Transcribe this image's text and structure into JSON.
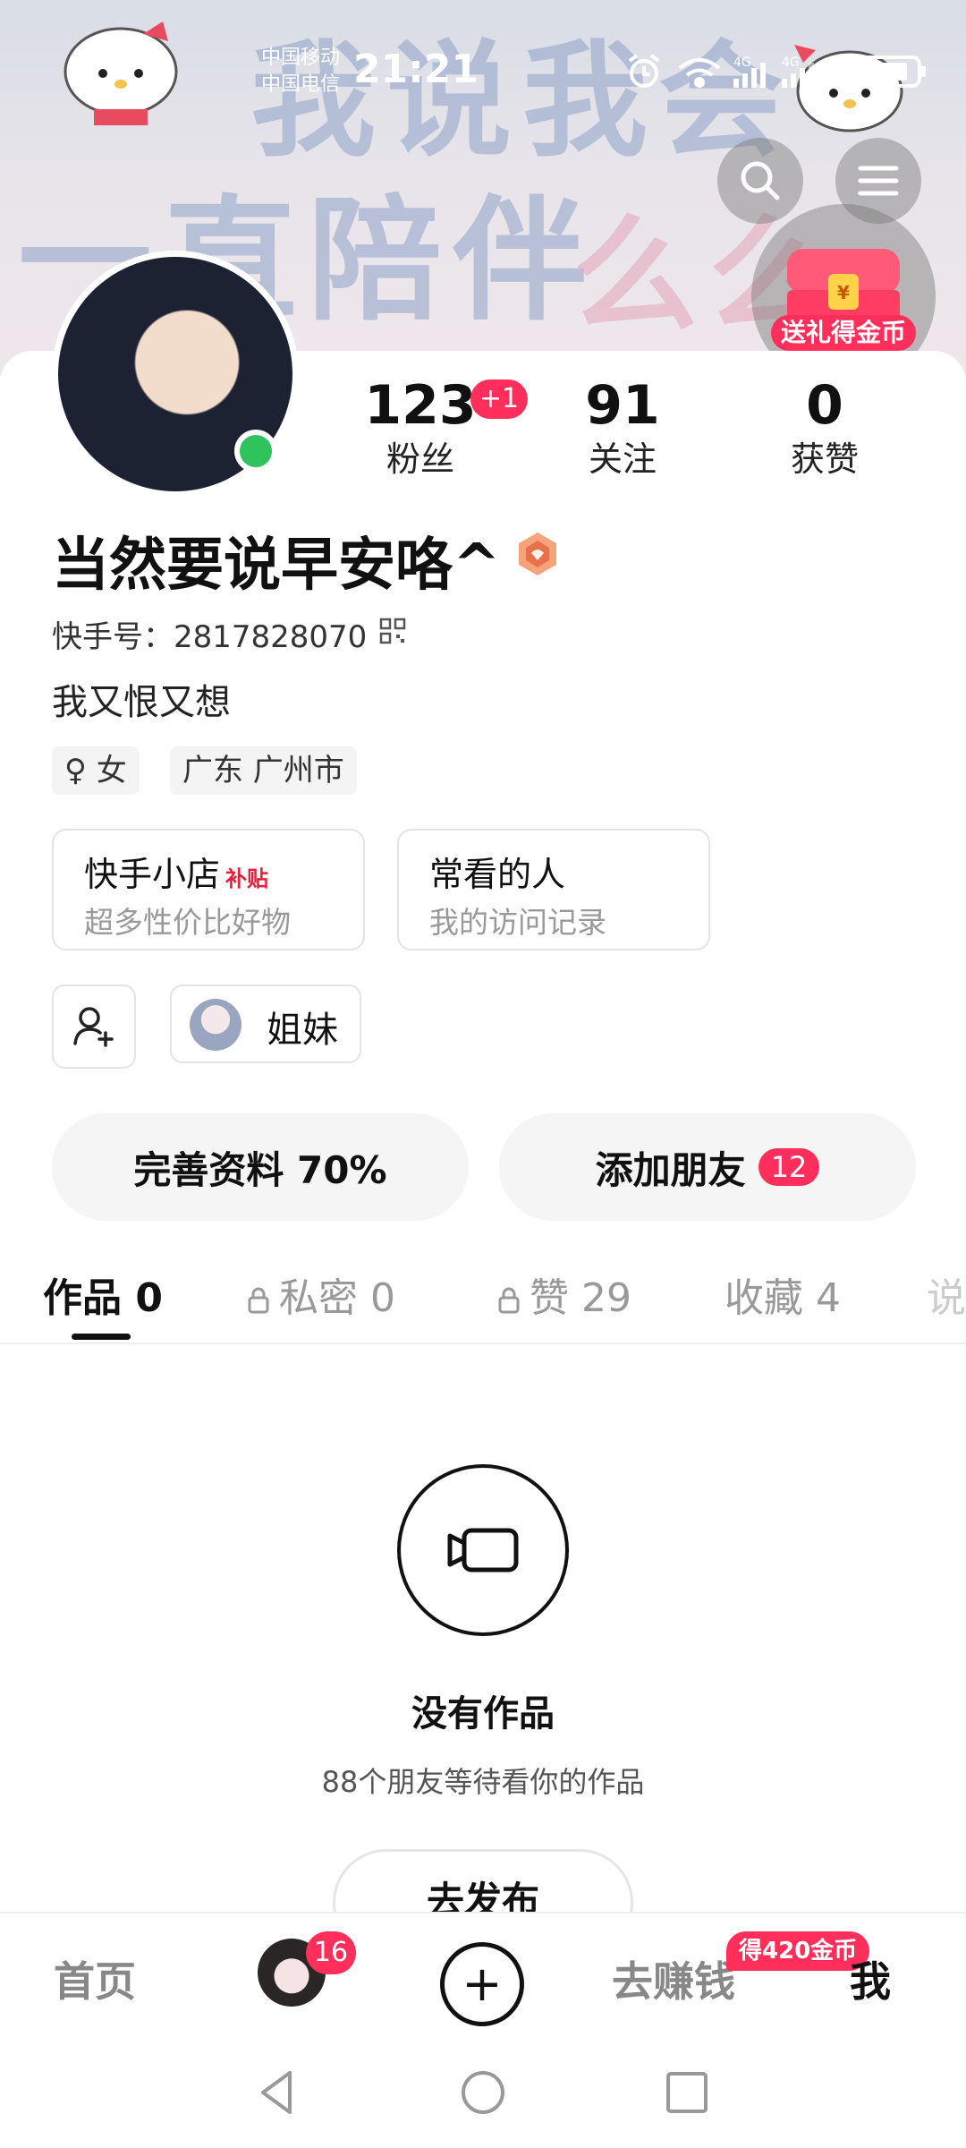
{
  "status_bar": {
    "carrier_1": "中国移动",
    "carrier_2": "中国电信",
    "time": "21:21",
    "signal_1": "4G",
    "signal_2": "4G"
  },
  "cover": {
    "line1": "我说我会",
    "line2": "一直陪伴",
    "line3": "么么",
    "gift_label": "送礼得金币"
  },
  "profile": {
    "nickname": "当然要说早安咯^",
    "uid_label": "快手号：",
    "uid": "2817828070",
    "bio": "我又恨又想",
    "gender_tag": "♀ 女",
    "location_tag": "广东 广州市"
  },
  "stats": [
    {
      "value": "123",
      "label": "粉丝"
    },
    {
      "value": "91",
      "label": "关注"
    },
    {
      "value": "0",
      "label": "获赞"
    }
  ],
  "fans_new_badge": "+1",
  "cards": [
    {
      "title": "快手小店",
      "extra": "补贴",
      "subtitle": "超多性价比好物"
    },
    {
      "title": "常看的人",
      "extra": "",
      "subtitle": "我的访问记录"
    }
  ],
  "group_chip": {
    "label": "姐妹"
  },
  "actions": {
    "complete_profile": "完善资料 70%",
    "add_friends": "添加朋友",
    "add_friends_count": "12"
  },
  "tabs": [
    {
      "label": "作品 0",
      "locked": false
    },
    {
      "label": "私密 0",
      "locked": true
    },
    {
      "label": "赞 29",
      "locked": true
    },
    {
      "label": "收藏 4",
      "locked": false
    },
    {
      "label": "说",
      "locked": false
    }
  ],
  "empty_state": {
    "title": "没有作品",
    "subtitle": "88个朋友等待看你的作品",
    "button": "去发布"
  },
  "bottom_nav": {
    "home": "首页",
    "friends_badge": "16",
    "create": "+",
    "earn": "去赚钱",
    "earn_badge": "得420金币",
    "me": "我"
  },
  "colors": {
    "accent": "#ff2e5a",
    "online": "#30c25b"
  }
}
